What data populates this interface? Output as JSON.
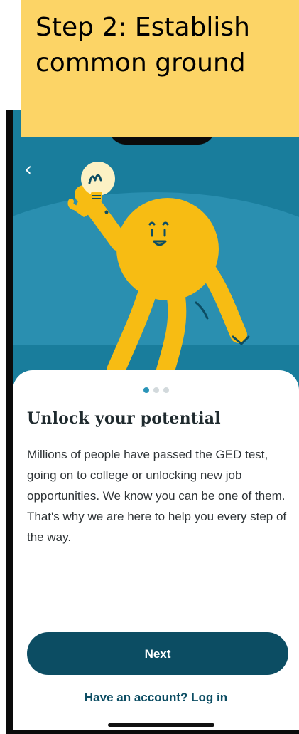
{
  "caption": {
    "text": "Step 2: Establish\ncommon ground"
  },
  "nav": {
    "back_icon": "chevron-left-icon",
    "back_glyph": "‹"
  },
  "hero": {
    "illustration": "lightbulb-character",
    "colors": {
      "sky": "#197d9c",
      "glow": "#2a8fb0",
      "character": "#f7bc13",
      "bulb": "#fcf1c4"
    }
  },
  "pager": {
    "total": 3,
    "active": 0
  },
  "content": {
    "title": "Unlock your potential",
    "body": "Millions of people have passed the GED test, going on to college or unlocking new job opportunities. We know you can be one of them. That's why we are here to help you every step of the way."
  },
  "actions": {
    "next_label": "Next",
    "login_label": "Have an account? Log in"
  },
  "colors": {
    "primary": "#0c4d63",
    "caption_bg": "#fcd466"
  }
}
